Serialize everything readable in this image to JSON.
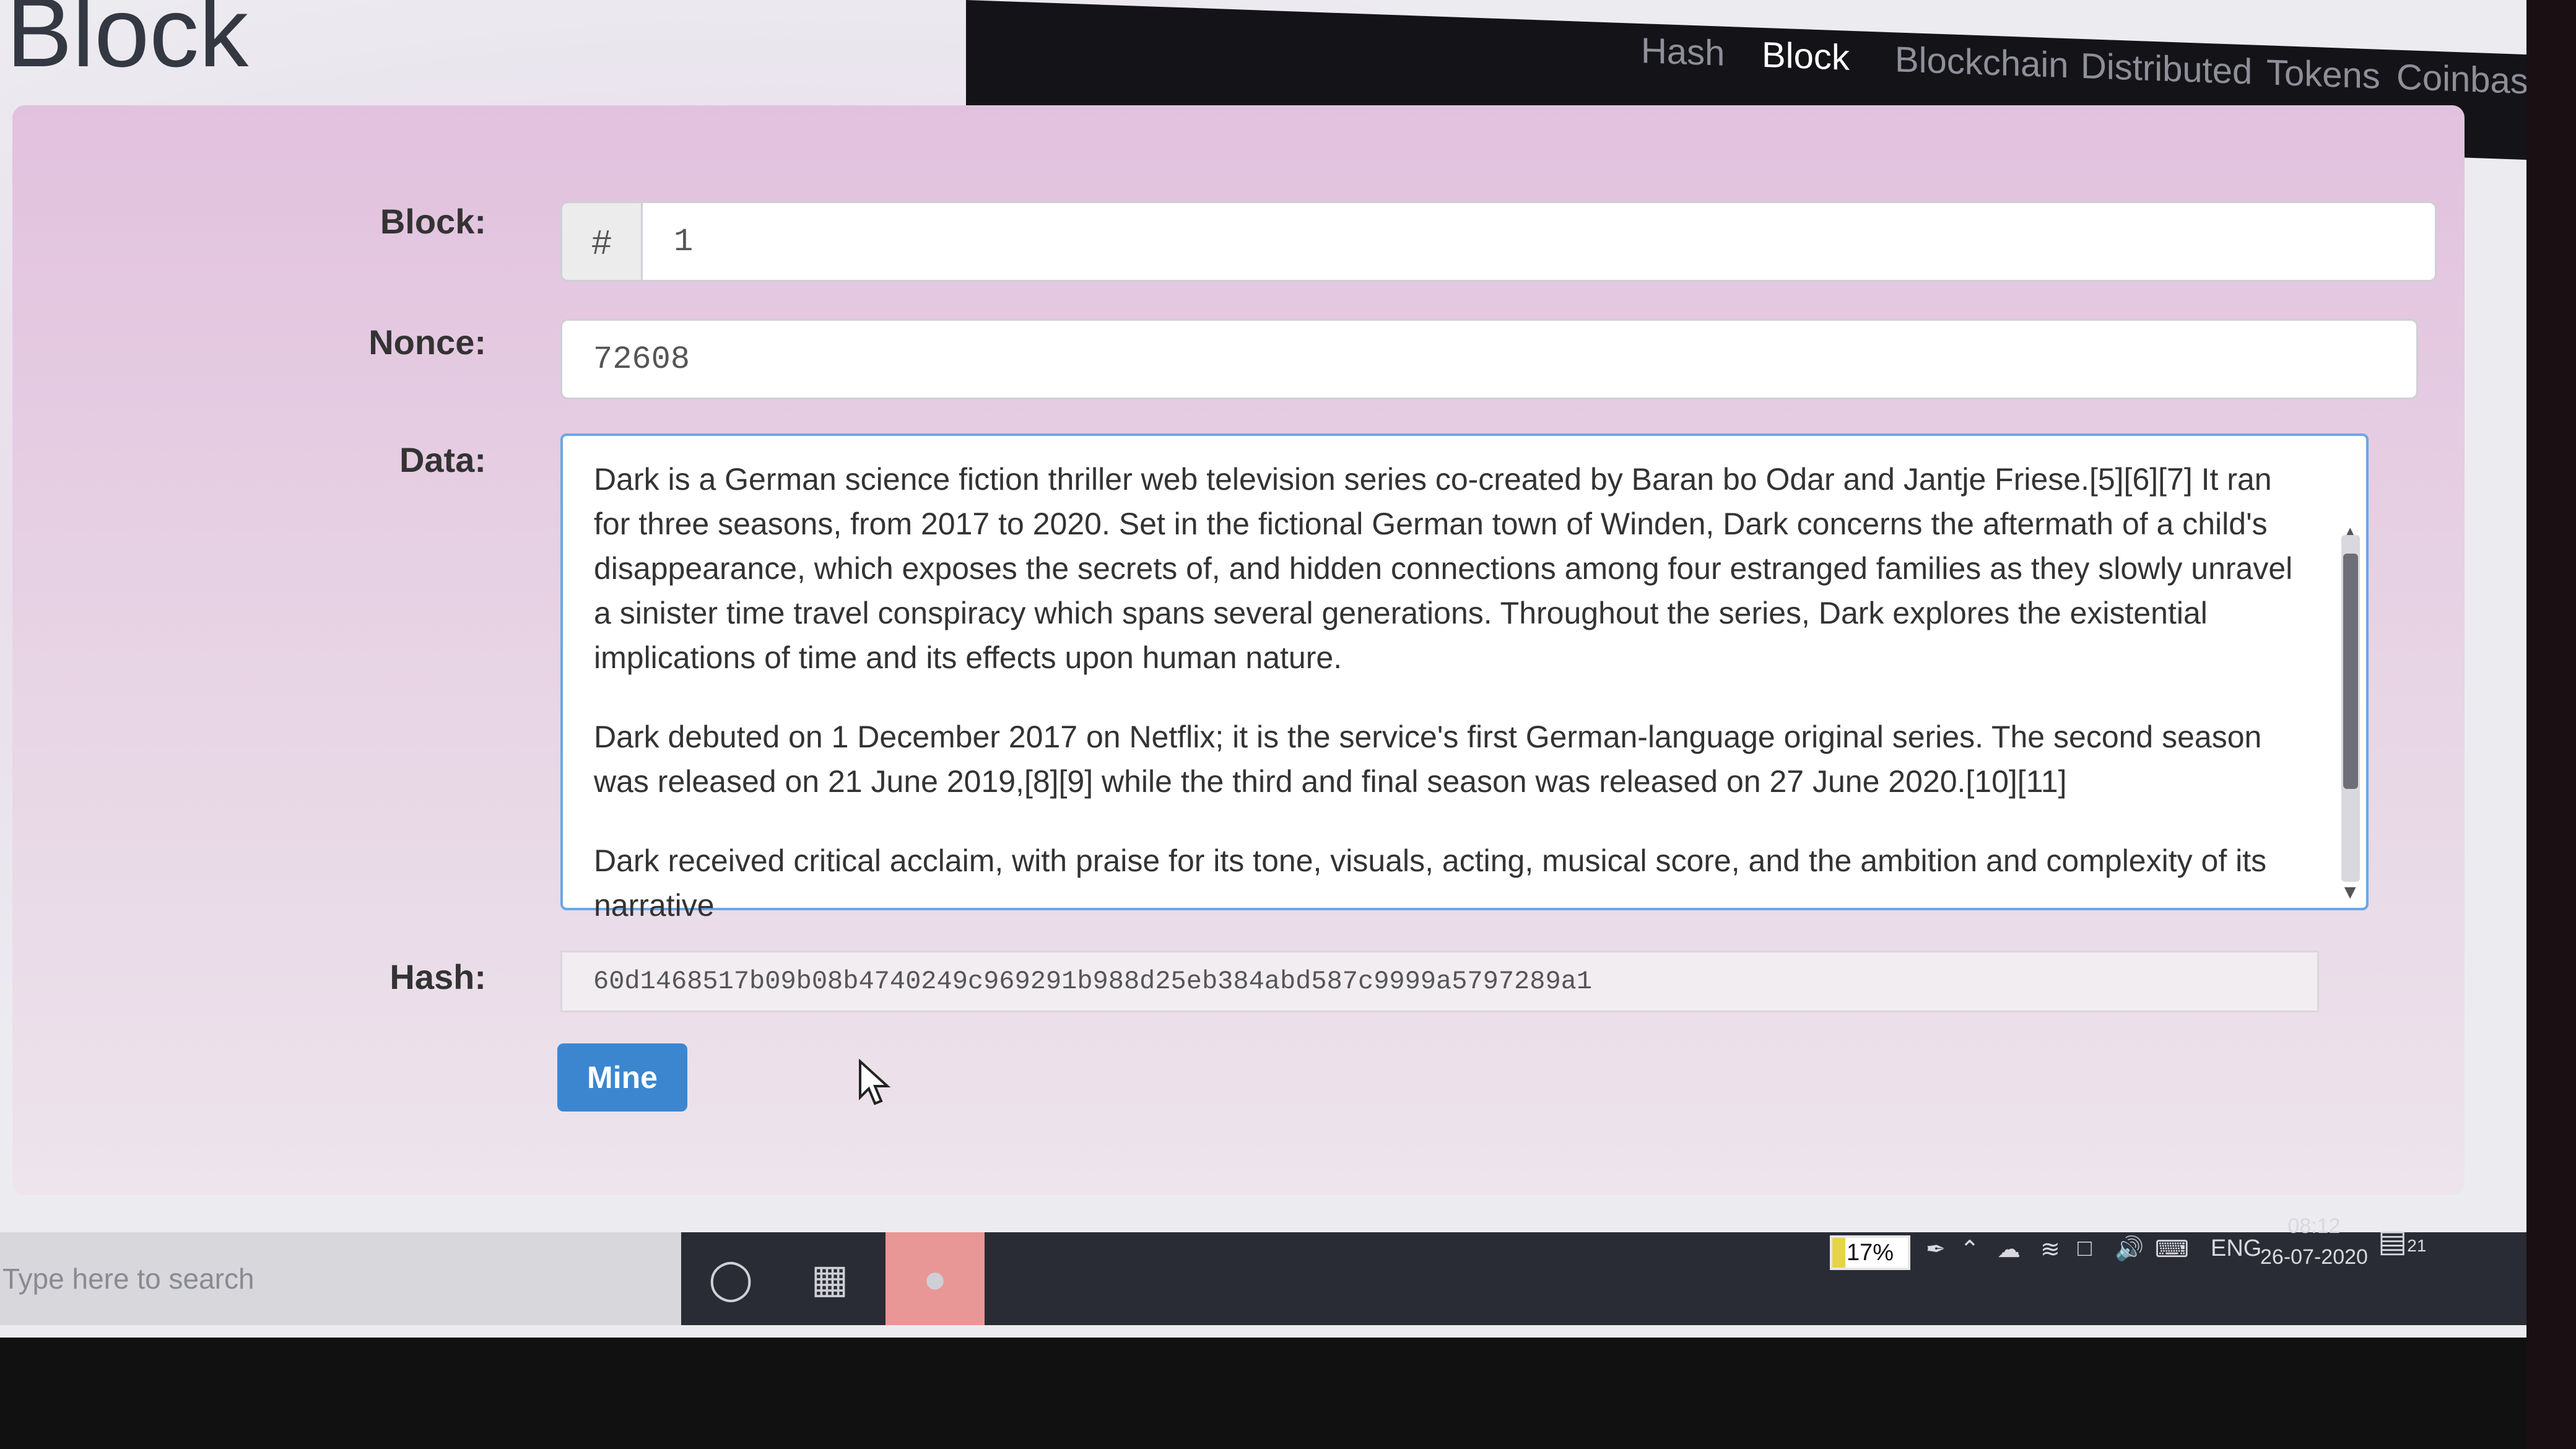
{
  "page": {
    "heading": "Block"
  },
  "nav": {
    "items": [
      "Hash",
      "Block",
      "Blockchain",
      "Distributed",
      "Tokens",
      "Coinbase"
    ],
    "active": "Block"
  },
  "form": {
    "block_label": "Block:",
    "block_prefix": "#",
    "block_value": "1",
    "nonce_label": "Nonce:",
    "nonce_value": "72608",
    "data_label": "Data:",
    "data_paragraphs": [
      "Dark is a German science fiction thriller web television series co-created by Baran bo Odar and Jantje Friese.[5][6][7] It ran for three seasons, from 2017 to 2020. Set in the fictional German town of Winden, Dark concerns the aftermath of a child's disappearance, which exposes the secrets of, and hidden connections among four estranged families as they slowly unravel a sinister time travel conspiracy which spans several generations. Throughout the series, Dark explores the existential implications of time and its effects upon human nature.",
      "Dark debuted on 1 December 2017 on Netflix; it is the service's first German-language original series. The second season was released on 21 June 2019,[8][9] while the third and final season was released on 27 June 2020.[10][11]",
      "Dark received critical acclaim, with praise for its tone, visuals, acting, musical score, and the ambition and complexity of its narrative"
    ],
    "hash_label": "Hash:",
    "hash_value": "60d1468517b09b08b4740249c969291b988d25eb384abd587c9999a5797289a1",
    "mine_label": "Mine"
  },
  "taskbar": {
    "search_placeholder": "Type here to search",
    "battery_percent": "17%",
    "battery_level": 0.17,
    "language": "ENG",
    "time": "08:12",
    "date": "26-07-2020",
    "notification_count": "21"
  }
}
